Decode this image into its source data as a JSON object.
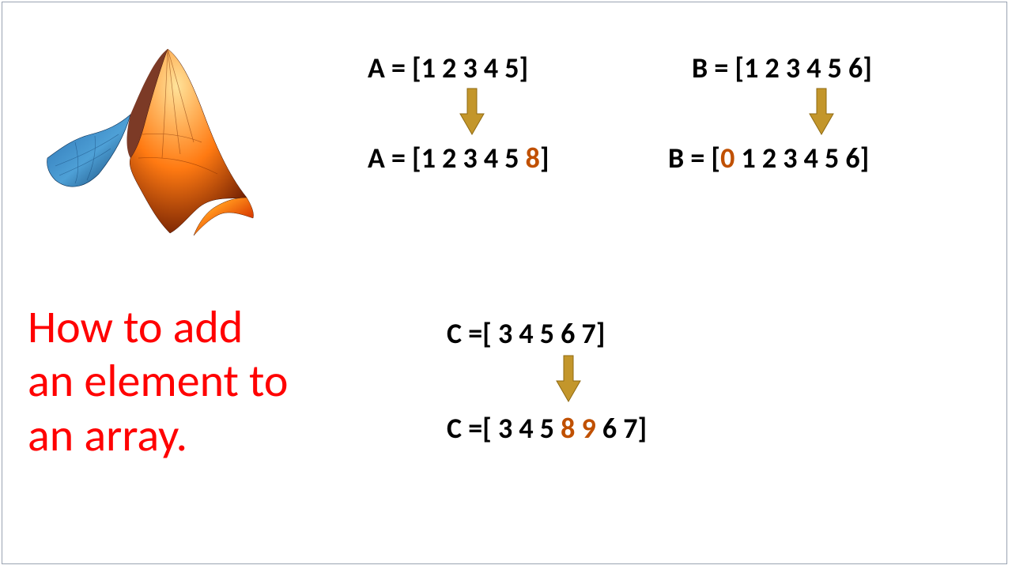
{
  "title": {
    "line1": "How to add",
    "line2": "an element to",
    "line3": "an array."
  },
  "A": {
    "before_prefix": "A = [1 2 3 4 5]",
    "after_prefix": "A = [1 2 3 4 5 ",
    "after_highlight": "8",
    "after_suffix": "]"
  },
  "B": {
    "before_prefix": "B = [1 2 3 4 5 6]",
    "after_prefix": "B = [",
    "after_highlight": "0",
    "after_mid": " 1 2 3 4 5 6]"
  },
  "C": {
    "before_prefix": "C =[ 3 4 5 6 7]",
    "after_prefix": "C =[ 3 4 5 ",
    "after_highlight": "8 9",
    "after_suffix": " 6 7]"
  },
  "colors": {
    "highlight": "#c05000",
    "arrow_fill": "#c3962b",
    "arrow_stroke": "#8f6a12",
    "title": "#ff0000"
  }
}
